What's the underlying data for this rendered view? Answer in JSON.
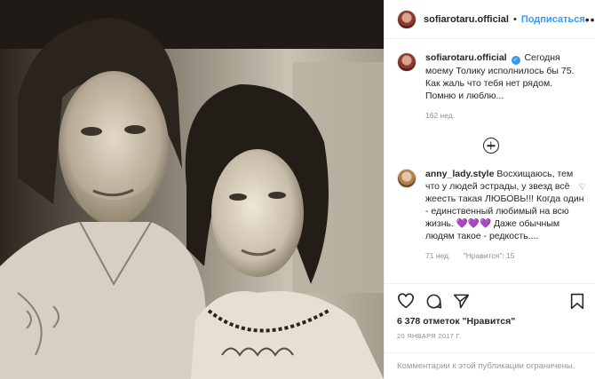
{
  "header": {
    "username": "sofiarotaru.official",
    "separator": "•",
    "follow_label": "Подписаться",
    "more_label": "•••"
  },
  "caption": {
    "username": "sofiarotaru.official",
    "verified_mark": "✓",
    "text": "Сегодня моему Толику исполнилось бы 75. Как жаль что тебя нет рядом. Помню и люблю...",
    "time": "162 нед."
  },
  "comments": [
    {
      "username": "anny_lady.style",
      "text": "Восхищаюсь, тем что у людей эстрады, у звезд всё жеесть такая ЛЮБОВЬ!!! Когда один - единственный любимый на всю жизнь. 💜💜💜 Даже обычным людям такое - редкость....",
      "time": "71 нед.",
      "likes": "\"Нравится\": 15"
    }
  ],
  "post": {
    "likes_text": "6 378 отметок \"Нравится\"",
    "date": "20 ЯНВАРЯ 2017 Г."
  },
  "footer": {
    "text": "Комментарии к этой публикации ограничены."
  },
  "icons": {
    "like": "heart-icon",
    "comment": "comment-icon",
    "share": "share-icon",
    "save": "bookmark-icon",
    "load_more": "plus-circle-icon"
  }
}
